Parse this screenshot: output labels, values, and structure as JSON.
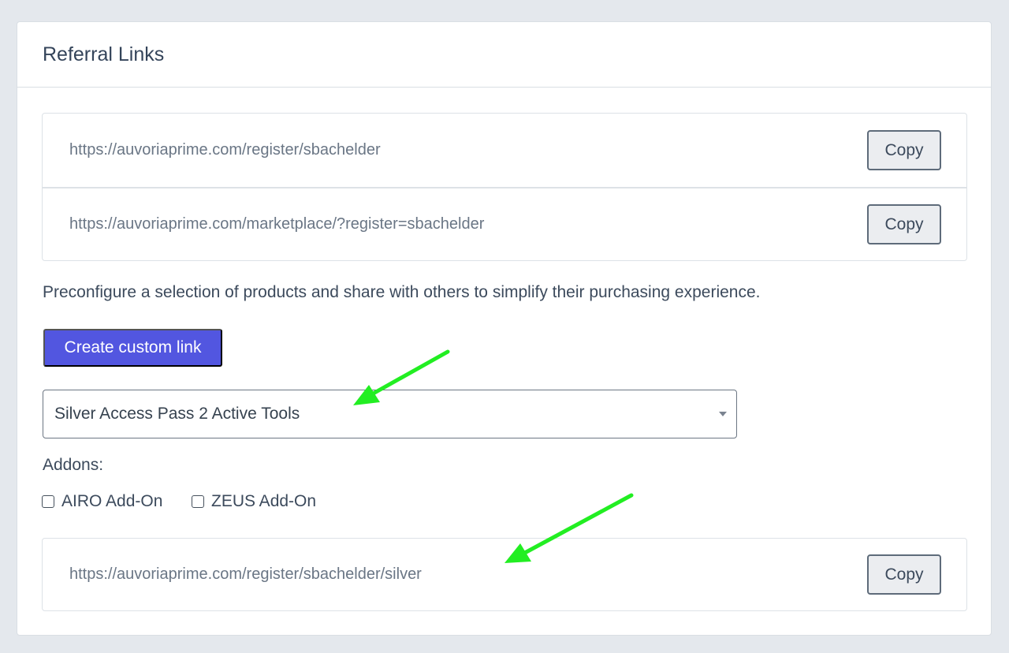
{
  "card": {
    "title": "Referral Links"
  },
  "links": [
    {
      "url": "https://auvoriaprime.com/register/sbachelder",
      "copy_label": "Copy"
    },
    {
      "url": "https://auvoriaprime.com/marketplace/?register=sbachelder",
      "copy_label": "Copy"
    }
  ],
  "description": "Preconfigure a selection of products and share with others to simplify their purchasing experience.",
  "create_button_label": "Create custom link",
  "product_select": {
    "value": "Silver Access Pass 2 Active Tools"
  },
  "addons": {
    "label": "Addons:",
    "options": [
      {
        "label": "AIRO Add-On",
        "checked": false
      },
      {
        "label": "ZEUS Add-On",
        "checked": false
      }
    ]
  },
  "custom_link": {
    "url": "https://auvoriaprime.com/register/sbachelder/silver",
    "copy_label": "Copy"
  },
  "colors": {
    "accent": "#5256e0",
    "annotation_arrow": "#22ee22"
  }
}
